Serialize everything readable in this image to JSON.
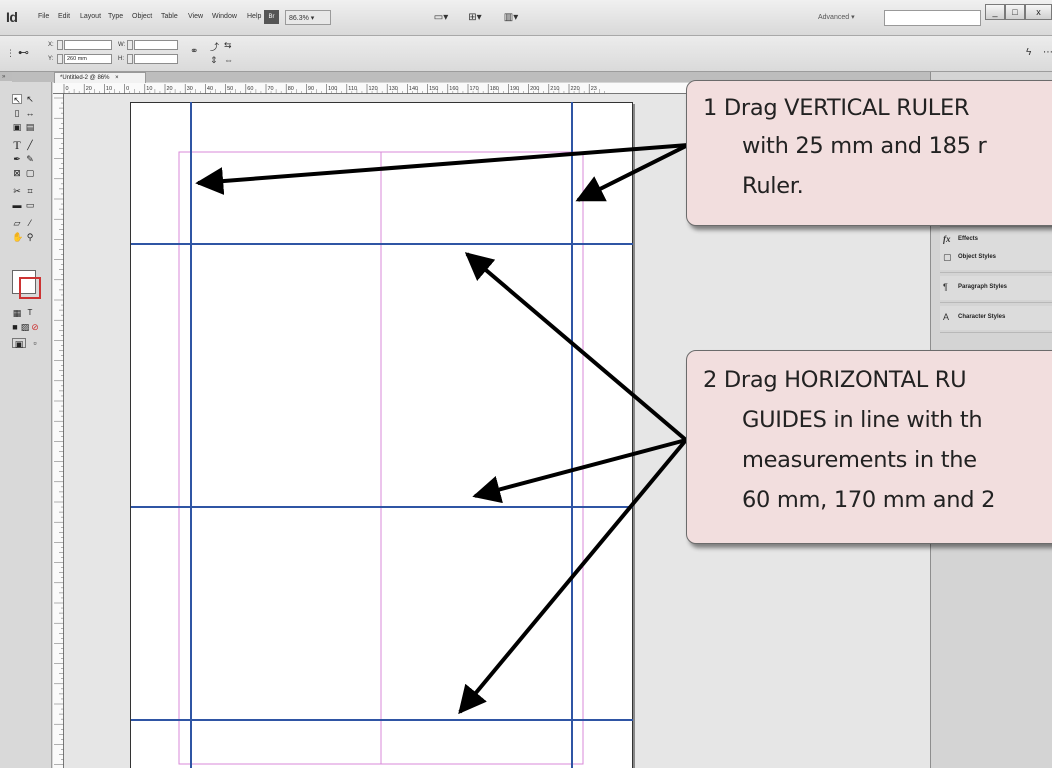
{
  "app": {
    "logo": "Id",
    "menus": [
      "File",
      "Edit",
      "Layout",
      "Type",
      "Object",
      "Table",
      "View",
      "Window",
      "Help"
    ],
    "zoom": "86.3%",
    "workspace": "Advanced",
    "window_buttons": [
      "_",
      "□",
      "x"
    ]
  },
  "control_bar": {
    "x_label": "X:",
    "y_label": "Y:",
    "w_label": "W:",
    "h_label": "H:",
    "y_value": "260 mm"
  },
  "document": {
    "tab_title": "*Untitled-2 @ 86%",
    "tab_close": "×",
    "ruler_ticks": [
      "0",
      "20",
      "10",
      "0",
      "10",
      "20",
      "30",
      "40",
      "50",
      "60",
      "70",
      "80",
      "90",
      "100",
      "110",
      "120",
      "130",
      "140",
      "150",
      "160",
      "170",
      "180",
      "190",
      "200",
      "210",
      "220",
      "23"
    ]
  },
  "panel": {
    "items": [
      {
        "icon": "fx",
        "label": "Effects"
      },
      {
        "icon": "▢",
        "label": "Object Styles"
      },
      {
        "icon": "¶",
        "label": "Paragraph Styles"
      },
      {
        "icon": "A",
        "label": "Character Styles"
      }
    ]
  },
  "callouts": {
    "step1": {
      "lines": [
        "1  Drag VERTICAL RULER",
        "with 25 mm and 185 r",
        "Ruler."
      ]
    },
    "step2": {
      "lines": [
        "2  Drag HORIZONTAL RU",
        "GUIDES in line with th",
        "measurements in the",
        "60 mm, 170 mm and 2"
      ]
    }
  },
  "colors": {
    "guide": "#2f55a4",
    "margin": "#d98ad8",
    "callout_bg": "#f2dede"
  }
}
